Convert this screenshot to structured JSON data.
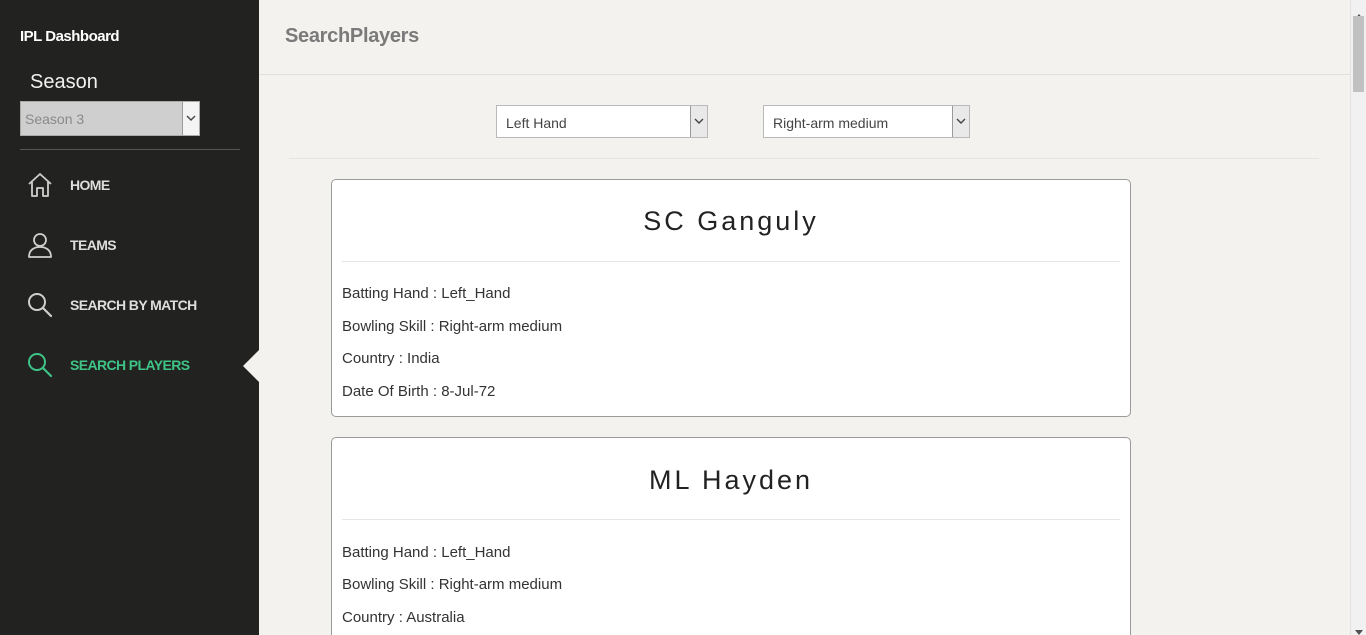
{
  "sidebar": {
    "brand": "IPL Dashboard",
    "season_label": "Season",
    "season_value": "Season 3",
    "nav": [
      {
        "label": "HOME",
        "icon": "home-icon"
      },
      {
        "label": "TEAMS",
        "icon": "user-icon"
      },
      {
        "label": "SEARCH BY MATCH",
        "icon": "search-icon"
      },
      {
        "label": "SEARCH PLAYERS",
        "icon": "search-icon",
        "active": true
      }
    ],
    "active_color": "#3ec487"
  },
  "header": {
    "title": "SearchPlayers"
  },
  "filters": {
    "batting_hand": "Left Hand",
    "bowling_skill": "Right-arm medium"
  },
  "players": [
    {
      "name": "SC Ganguly",
      "batting": "Batting Hand : Left_Hand",
      "bowling": "Bowling Skill : Right-arm medium",
      "country": "Country : India",
      "dob": "Date Of Birth : 8-Jul-72"
    },
    {
      "name": "ML Hayden",
      "batting": "Batting Hand : Left_Hand",
      "bowling": "Bowling Skill : Right-arm medium",
      "country": "Country : Australia"
    }
  ]
}
